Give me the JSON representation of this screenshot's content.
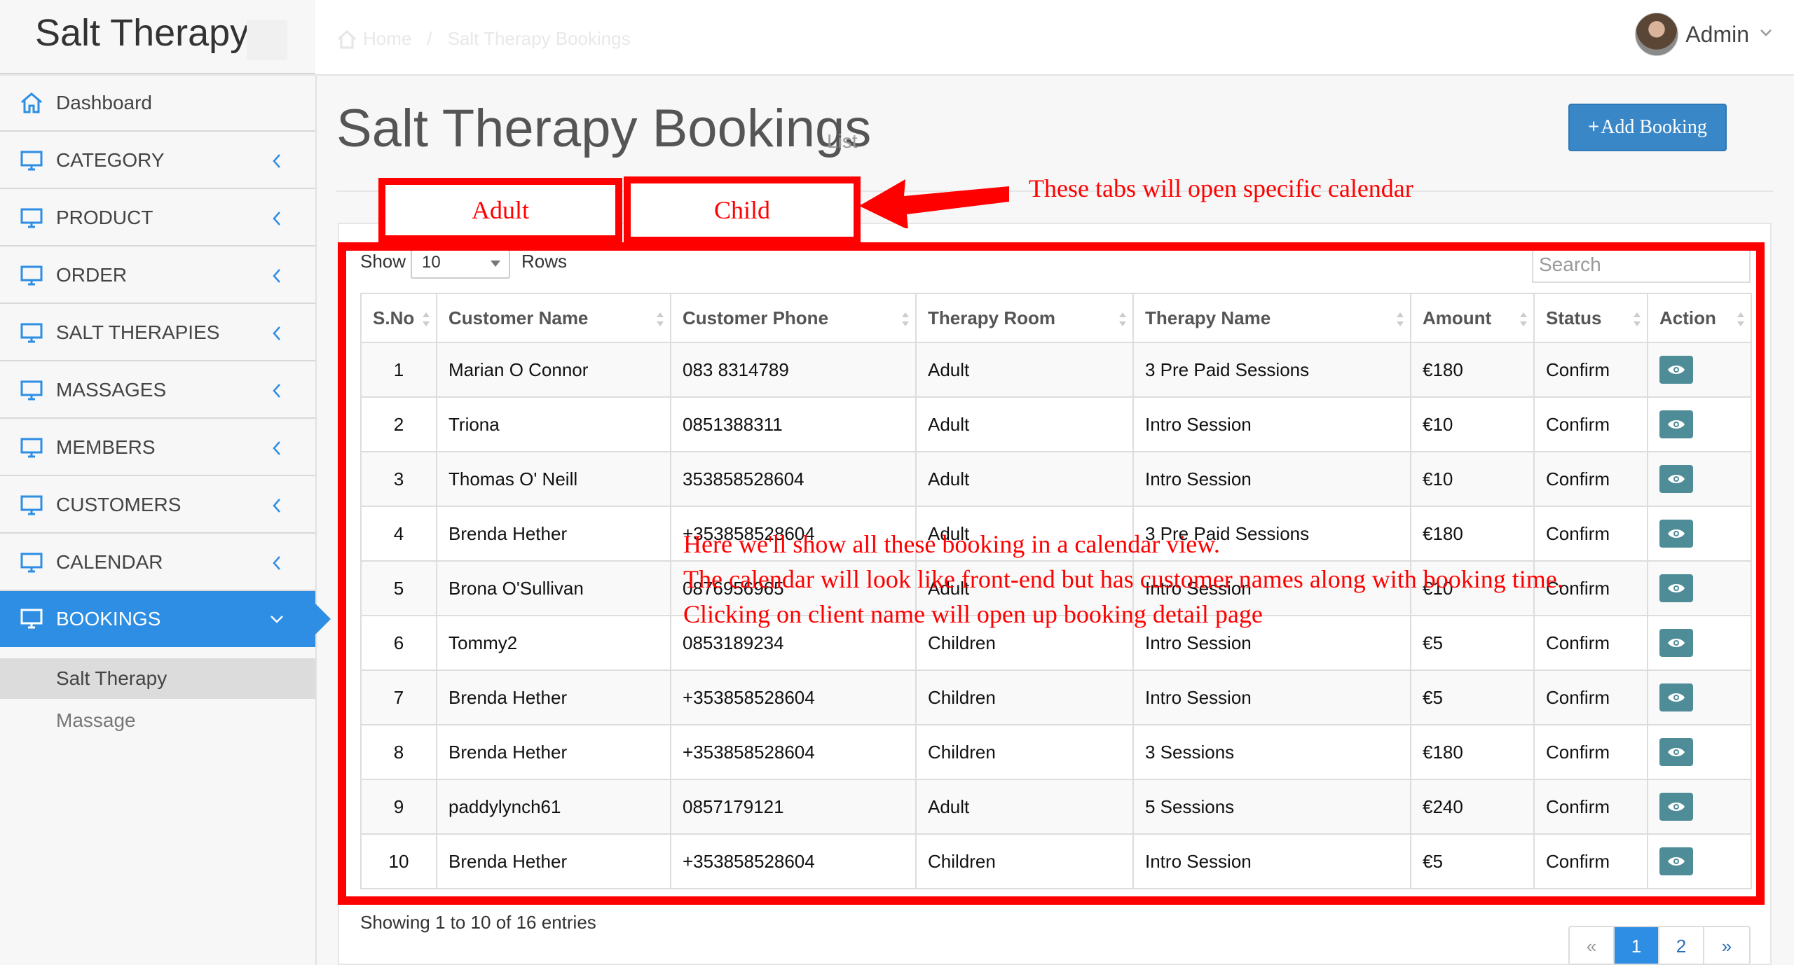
{
  "app": {
    "brand": "Salt Therapy"
  },
  "breadcrumb": {
    "home": "Home",
    "current": "Salt Therapy Bookings"
  },
  "user": {
    "name": "Admin"
  },
  "sidebar": {
    "items": [
      {
        "label": "Dashboard",
        "icon": "home-icon"
      },
      {
        "label": "CATEGORY",
        "icon": "monitor-icon"
      },
      {
        "label": "PRODUCT",
        "icon": "monitor-icon"
      },
      {
        "label": "ORDER",
        "icon": "monitor-icon"
      },
      {
        "label": "SALT THERAPIES",
        "icon": "monitor-icon"
      },
      {
        "label": "MASSAGES",
        "icon": "monitor-icon"
      },
      {
        "label": "MEMBERS",
        "icon": "monitor-icon"
      },
      {
        "label": "CUSTOMERS",
        "icon": "monitor-icon"
      },
      {
        "label": "CALENDAR",
        "icon": "monitor-icon"
      },
      {
        "label": "BOOKINGS",
        "icon": "monitor-icon"
      }
    ],
    "sub_items": [
      {
        "label": "Salt Therapy"
      },
      {
        "label": "Massage"
      }
    ],
    "active_color": "#2d8ee4"
  },
  "page": {
    "title": "Salt Therapy Bookings",
    "subtitle": "List",
    "add_button": "Add Booking"
  },
  "annotations": {
    "tab_adult": "Adult",
    "tab_child": "Child",
    "tabs_note": "These tabs will open specific calendar",
    "line1": "Here we'll show all these booking in a calendar view.",
    "line2": "The calendar will look like front-end but has customer names along with booking time.",
    "line3": "Clicking on client name will open up booking detail page",
    "color": "#ff0000"
  },
  "table": {
    "show_label": "Show",
    "rows_value": "10",
    "rows_label": "Rows",
    "search_placeholder": "Search",
    "columns": [
      "S.No",
      "Customer Name",
      "Customer Phone",
      "Therapy Room",
      "Therapy Name",
      "Amount",
      "Status",
      "Action"
    ],
    "rows": [
      [
        "1",
        "Marian O Connor",
        "083 8314789",
        "Adult",
        "3 Pre Paid Sessions",
        "€180",
        "Confirm"
      ],
      [
        "2",
        "Triona",
        "0851388311",
        "Adult",
        "Intro Session",
        "€10",
        "Confirm"
      ],
      [
        "3",
        "Thomas O' Neill",
        "353858528604",
        "Adult",
        "Intro Session",
        "€10",
        "Confirm"
      ],
      [
        "4",
        "Brenda Hether",
        "+353858528604",
        "Adult",
        "3 Pre Paid Sessions",
        "€180",
        "Confirm"
      ],
      [
        "5",
        "Brona O'Sullivan",
        "0876956965",
        "Adult",
        "Intro Session",
        "€10",
        "Confirm"
      ],
      [
        "6",
        "Tommy2",
        "0853189234",
        "Children",
        "Intro Session",
        "€5",
        "Confirm"
      ],
      [
        "7",
        "Brenda Hether",
        "+353858528604",
        "Children",
        "Intro Session",
        "€5",
        "Confirm"
      ],
      [
        "8",
        "Brenda Hether",
        "+353858528604",
        "Children",
        "3 Sessions",
        "€180",
        "Confirm"
      ],
      [
        "9",
        "paddylynch61",
        "0857179121",
        "Adult",
        "5 Sessions",
        "€240",
        "Confirm"
      ],
      [
        "10",
        "Brenda Hether",
        "+353858528604",
        "Children",
        "Intro Session",
        "€5",
        "Confirm"
      ]
    ],
    "showing": "Showing 1 to 10 of 16 entries",
    "pager": {
      "prev": "«",
      "pages": [
        "1",
        "2"
      ],
      "next": "»",
      "current": "1"
    }
  }
}
